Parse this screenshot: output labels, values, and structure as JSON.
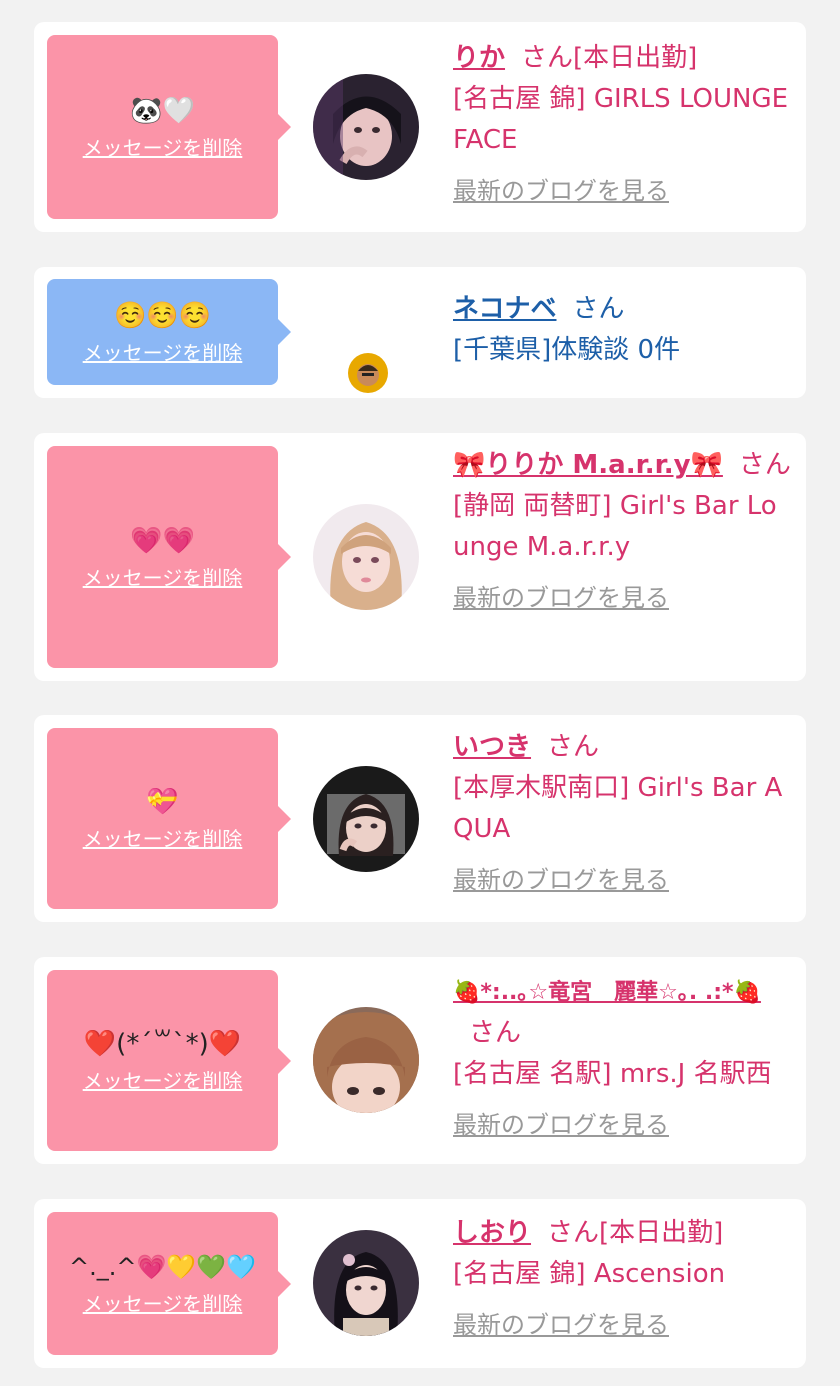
{
  "delete_label": "メッセージを削除",
  "blog_label": "最新のブログを見る",
  "honorific": "さん",
  "colors": {
    "pink": "#fb94a8",
    "blue": "#8bb7f5",
    "name_pink": "#d6336c",
    "name_blue": "#1d5fa8",
    "link_gray": "#999999"
  },
  "messages": [
    {
      "message": "🐼🤍",
      "name": "りか",
      "status": "[本日出勤]",
      "shop": "[名古屋 錦] GIRLS LOUNGE FACE"
    },
    {
      "message": "☺️☺️☺️",
      "name": "ネコナベ",
      "shop": "[千葉県]体験談 0件"
    },
    {
      "message": "💗💗",
      "name": "🎀りりか M.a.r.r.y🎀",
      "shop": "[静岡 両替町] Girl's Bar Lounge M.a.r.r.y"
    },
    {
      "message": "💝",
      "name": "いつき",
      "shop": "[本厚木駅南口] Girl's Bar AQUA"
    },
    {
      "message": "❤️(*´꒳`*)❤️",
      "name": "🍓*:..｡☆竜宮　麗華☆｡. .:*🍓",
      "shop": "[名古屋 名駅] mrs.J 名駅西"
    },
    {
      "message": "^._.^💗💛💚🩵",
      "name": "しおり",
      "status": "[本日出勤]",
      "shop": "[名古屋 錦] Ascension"
    }
  ]
}
